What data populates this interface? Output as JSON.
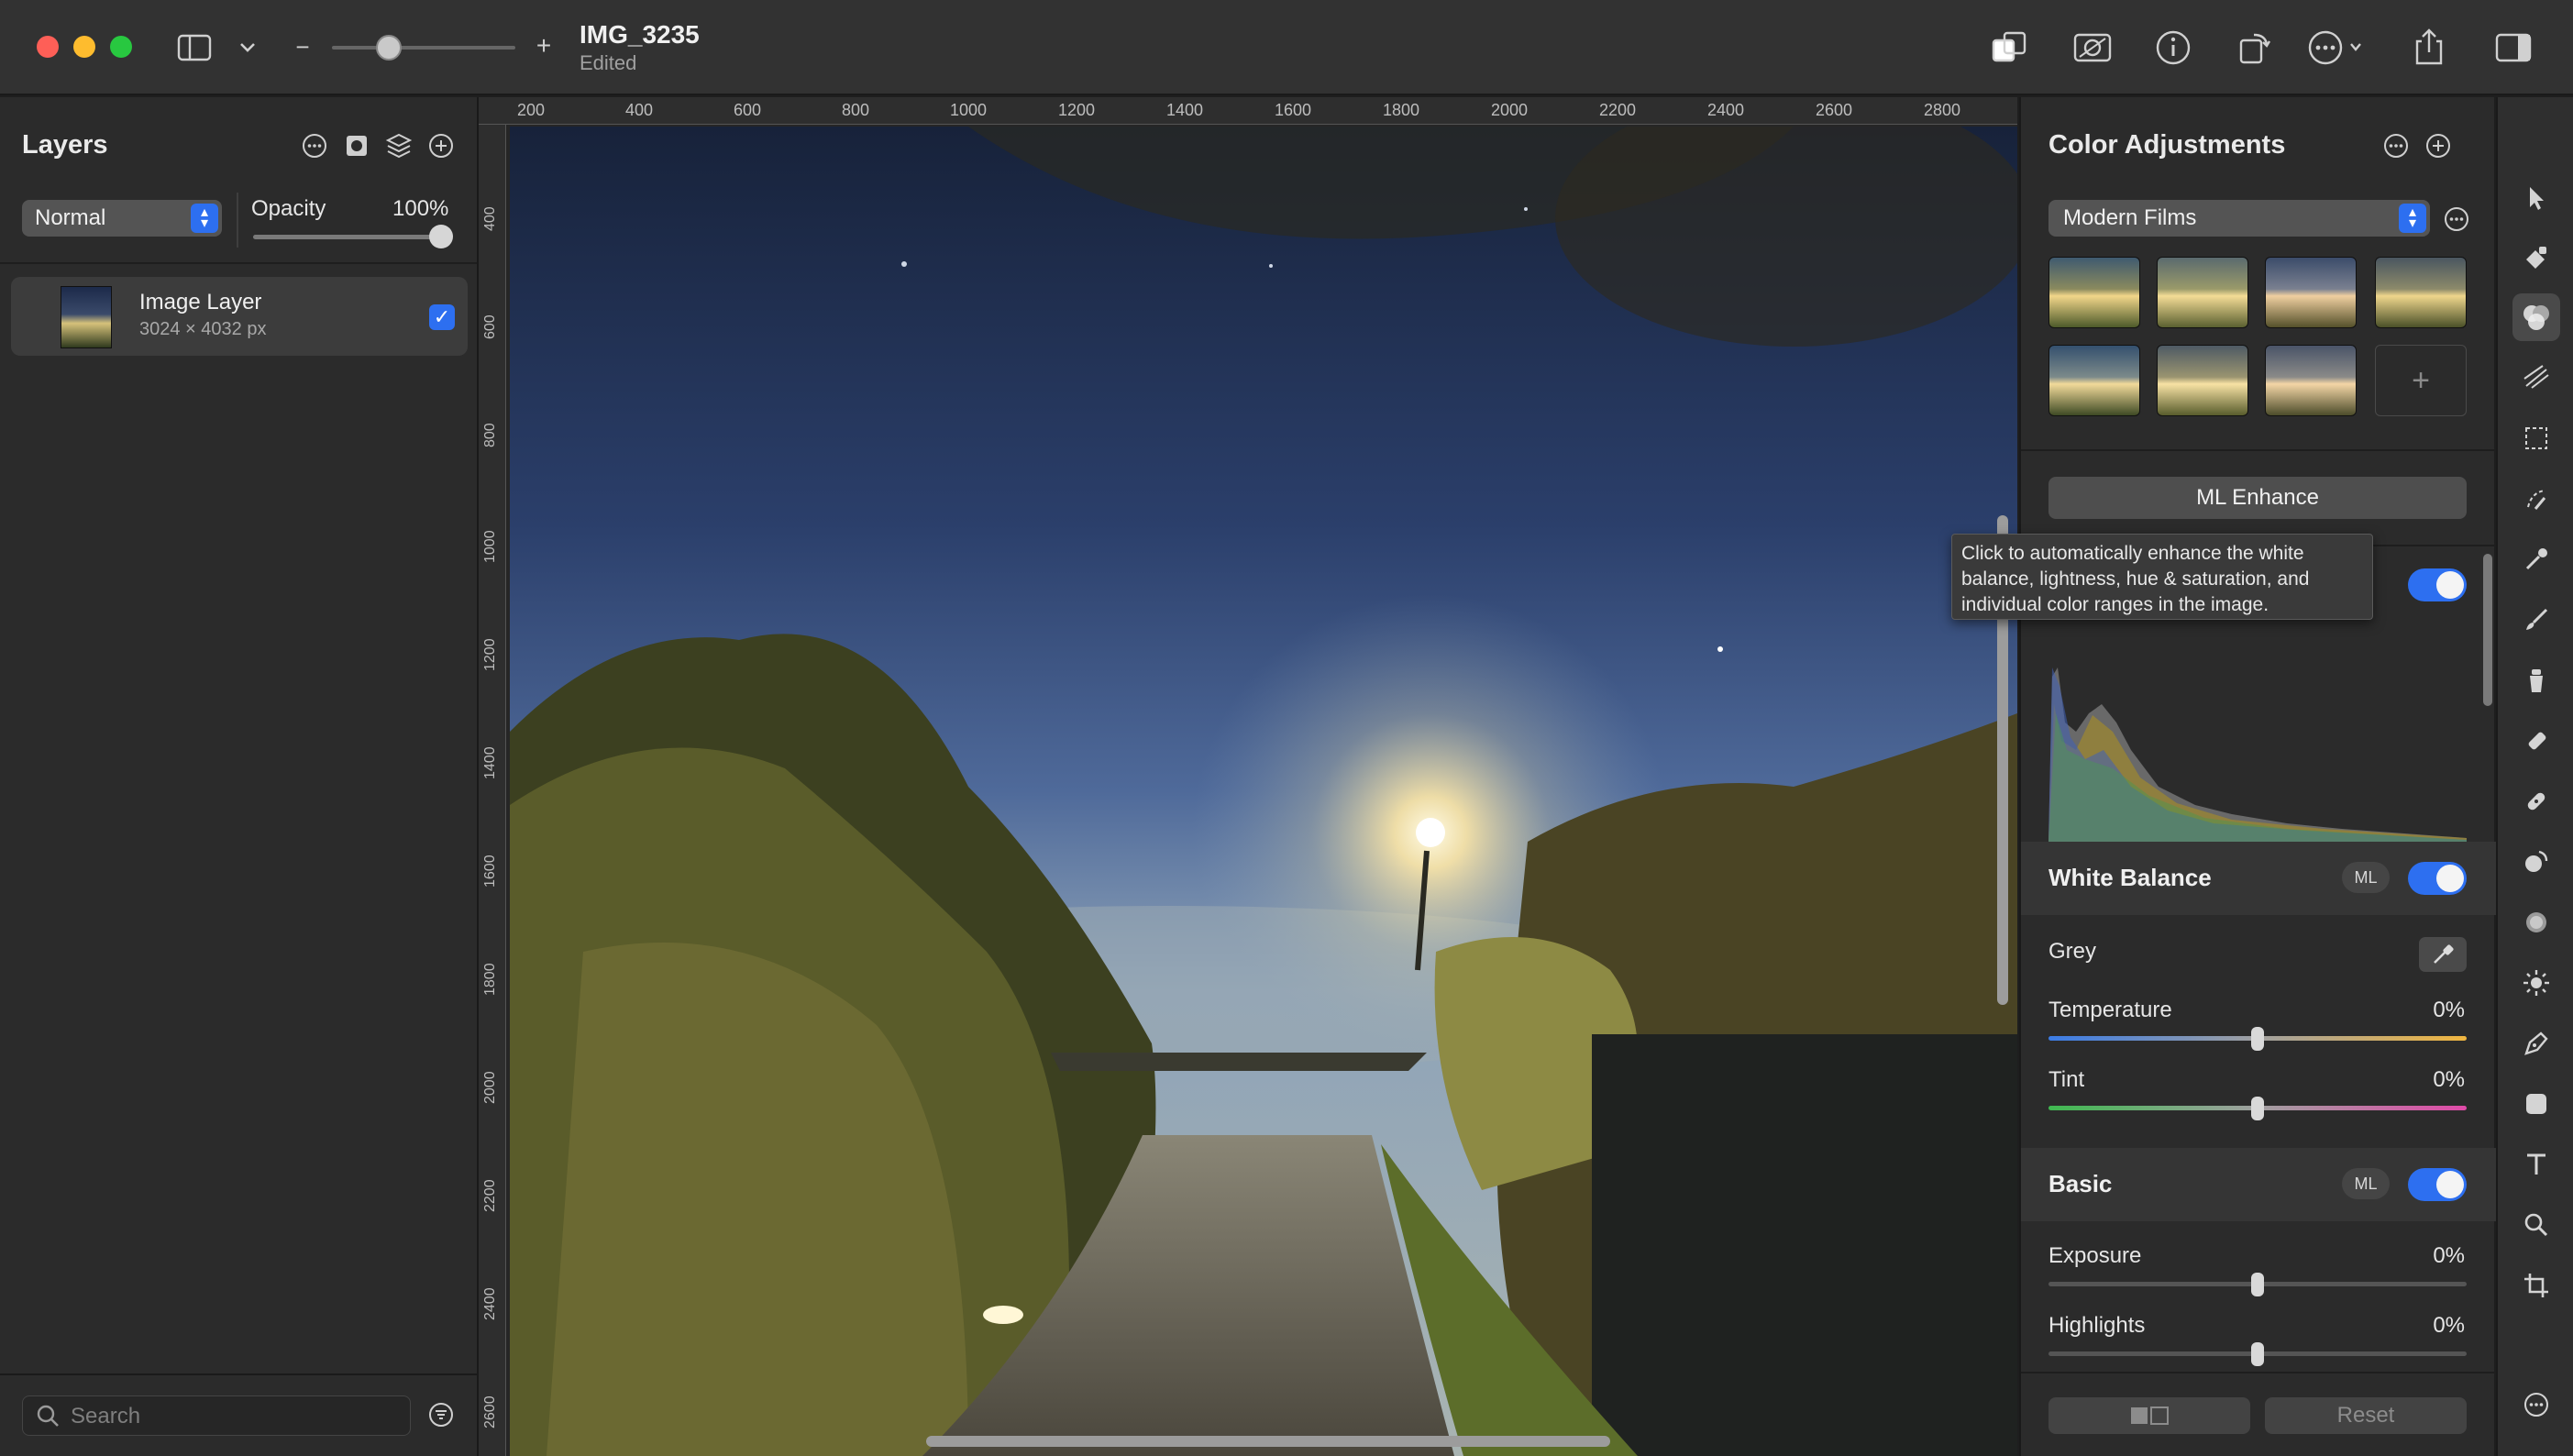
{
  "window": {
    "title": "IMG_3235",
    "subtitle": "Edited"
  },
  "toolbar": {
    "zoom_minus": "−",
    "zoom_plus": "+",
    "icons": [
      "sidebar-toggle-icon",
      "chevron-down-icon",
      "compare-icon",
      "ml-mask-icon",
      "info-icon",
      "rotate-icon",
      "more-icon",
      "share-icon",
      "inspector-toggle-icon"
    ]
  },
  "layers_panel": {
    "title": "Layers",
    "blend_mode": "Normal",
    "opacity_label": "Opacity",
    "opacity_value": "100%",
    "opacity_fraction": 1.0,
    "layers": [
      {
        "name": "Image Layer",
        "size": "3024 × 4032 px",
        "visible": true
      }
    ],
    "search_placeholder": "Search"
  },
  "canvas": {
    "ruler_h": [
      "200",
      "400",
      "600",
      "800",
      "1000",
      "1200",
      "1400",
      "1600",
      "1800",
      "2000",
      "2200",
      "2400",
      "2600",
      "2800"
    ],
    "ruler_v": [
      "400",
      "600",
      "800",
      "1000",
      "1200",
      "1400",
      "1600",
      "1800",
      "2000",
      "2200",
      "2400",
      "2600"
    ]
  },
  "adjustments_panel": {
    "title": "Color Adjustments",
    "preset_group": "Modern Films",
    "preset_count": 7,
    "add_preset": "+",
    "ml_enhance_label": "ML Enhance",
    "tooltip": "Click to automatically enhance the white balance, lightness, hue & saturation, and individual color ranges in the image.",
    "master_enabled": true,
    "sections": {
      "white_balance": {
        "title": "White Balance",
        "badge": "ML",
        "enabled": true,
        "grey_label": "Grey",
        "temperature": {
          "label": "Temperature",
          "value": "0%",
          "fraction": 0.5
        },
        "tint": {
          "label": "Tint",
          "value": "0%",
          "fraction": 0.5
        }
      },
      "basic": {
        "title": "Basic",
        "badge": "ML",
        "enabled": true,
        "exposure": {
          "label": "Exposure",
          "value": "0%",
          "fraction": 0.5
        },
        "highlights": {
          "label": "Highlights",
          "value": "0%",
          "fraction": 0.5
        }
      }
    },
    "footer": {
      "reset_label": "Reset"
    }
  },
  "tool_rail": {
    "tools": [
      "select-tool-icon",
      "paint-style-icon",
      "color-adjust-tool-icon",
      "effects-tool-icon",
      "rect-select-tool-icon",
      "quick-select-tool-icon",
      "color-picker-tool-icon",
      "brush-tool-icon",
      "clone-tool-icon",
      "eraser-tool-icon",
      "retouch-tool-icon",
      "blend-tool-icon",
      "blur-tool-icon",
      "light-tool-icon",
      "pen-tool-icon",
      "shape-tool-icon",
      "text-tool-icon",
      "zoom-tool-icon",
      "crop-tool-icon",
      "more-tools-icon"
    ],
    "active_index": 2
  },
  "colors": {
    "accent": "#2d6ff0",
    "panel_bg": "#2b2b2b",
    "toolbar_bg": "#323232"
  }
}
